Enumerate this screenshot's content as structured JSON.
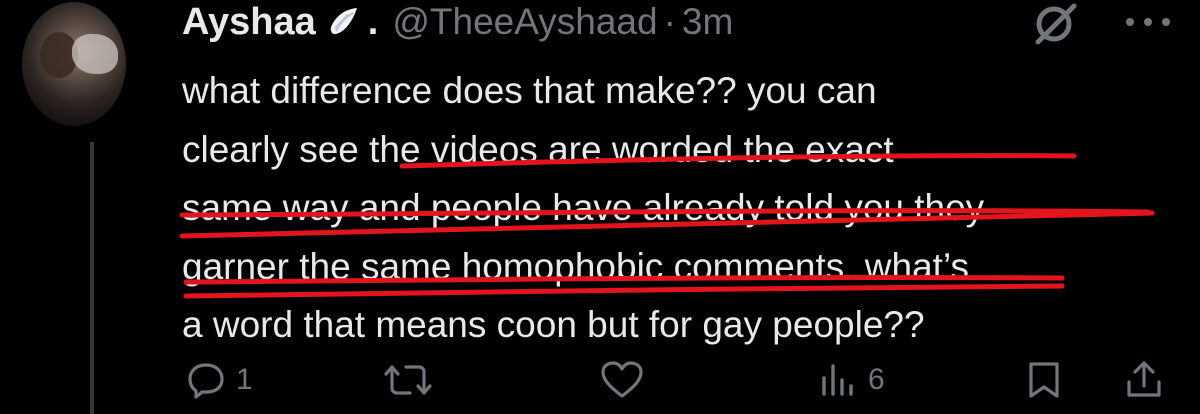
{
  "tweet": {
    "display_name": "Ayshaa",
    "name_suffix": ".",
    "handle": "@TheeAyshaad",
    "separator": "·",
    "time": "3m",
    "lines": [
      "what difference does that make?? you can",
      "clearly see the videos are worded the exact",
      "same way and people have already told you they",
      "garner the same homophobic comments. what’s",
      "a word that means coon but for gay people??"
    ]
  },
  "actions": {
    "reply_count": "1",
    "views_count": "6"
  },
  "colors": {
    "background": "#000000",
    "text": "#e7e9ea",
    "muted": "#71767b",
    "annotation_red": "#e3141b"
  },
  "icons": [
    "avatar",
    "angel-wing-icon",
    "grok-icon",
    "more-icon",
    "reply-icon",
    "retweet-icon",
    "like-icon",
    "views-icon",
    "bookmark-icon",
    "share-icon"
  ]
}
